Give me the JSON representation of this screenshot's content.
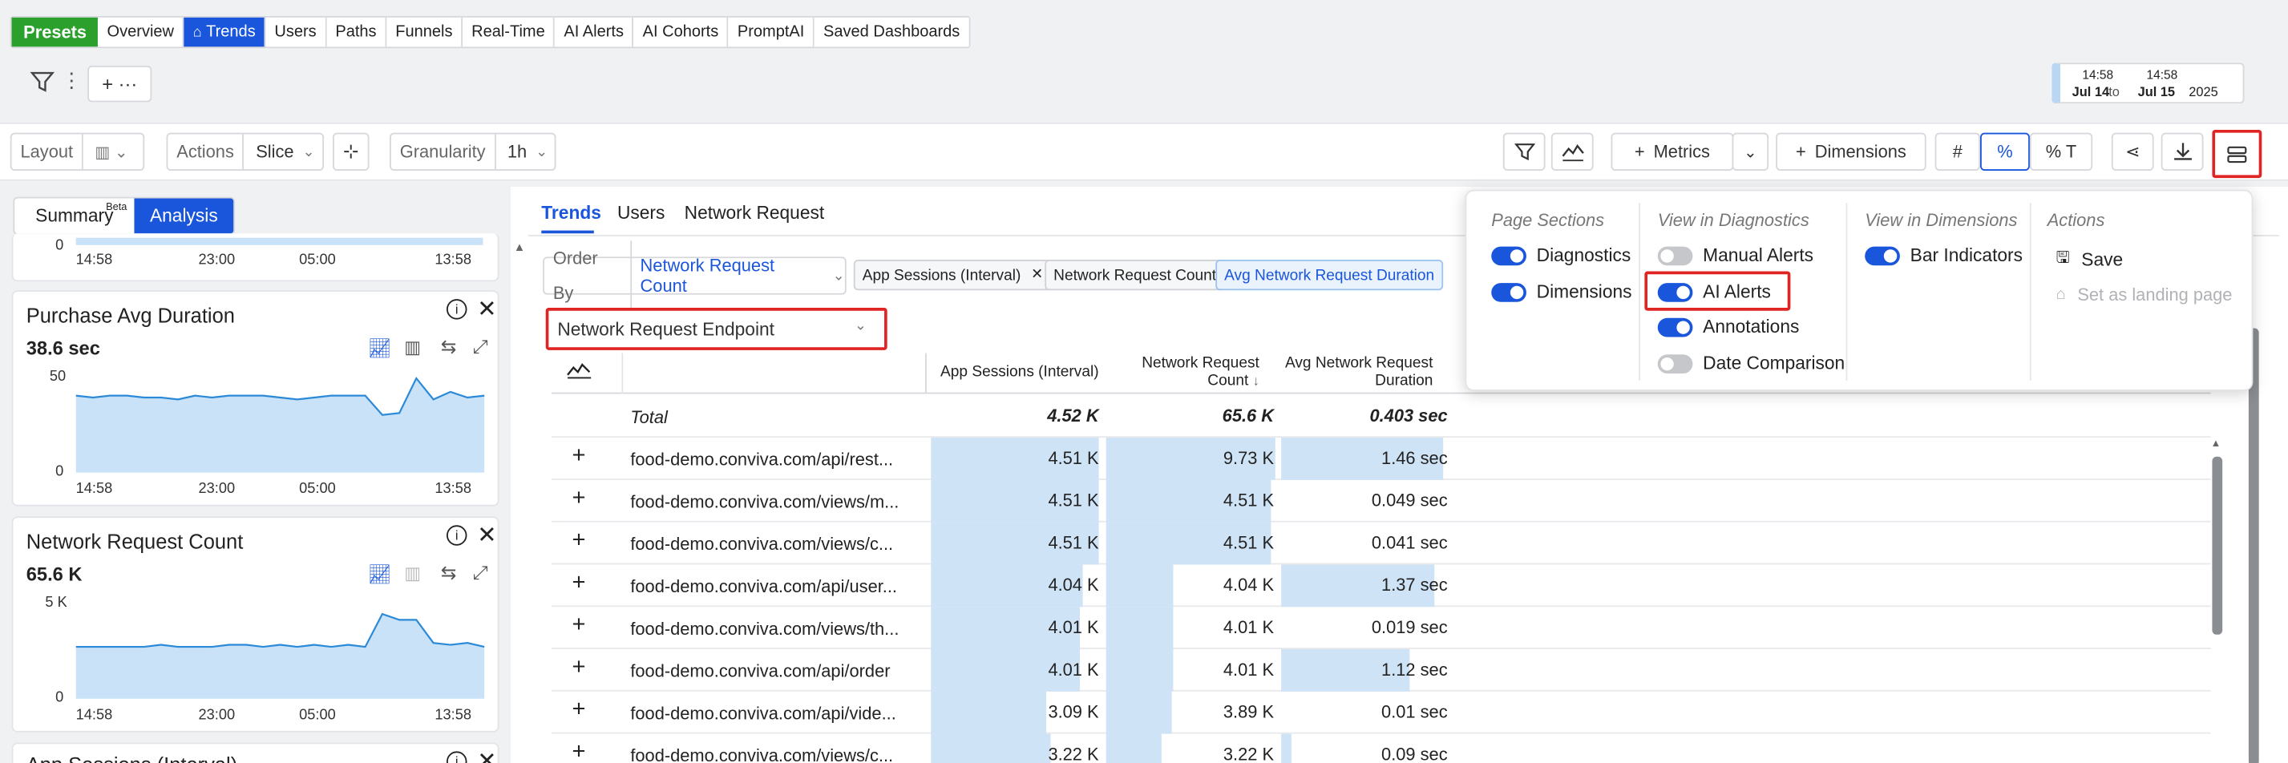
{
  "nav": {
    "presets": "Presets",
    "tabs": [
      "Overview",
      "Trends",
      "Users",
      "Paths",
      "Funnels",
      "Real-Time",
      "AI Alerts",
      "AI Cohorts",
      "PromptAI",
      "Saved Dashboards"
    ]
  },
  "date_range": {
    "start_time": "14:58",
    "start_date": "Jul 14",
    "to": "to",
    "end_time": "14:58",
    "end_date": "Jul 15",
    "year": "2025"
  },
  "filter": {
    "add_label": "+ ···"
  },
  "toolbar": {
    "layout_label": "Layout",
    "actions_label": "Actions",
    "slice_label": "Slice",
    "granularity_label": "Granularity",
    "granularity_value": "1h",
    "metrics_label": "Metrics",
    "dimensions_label": "Dimensions",
    "fmt_number": "#",
    "fmt_percent": "%",
    "fmt_percent_total": "% T"
  },
  "left": {
    "tabs": {
      "summary": "Summary",
      "beta": "Beta",
      "analysis": "Analysis"
    },
    "top_axis": {
      "zero": "0",
      "x": [
        "14:58",
        "23:00",
        "05:00",
        "13:58"
      ]
    },
    "panels": [
      {
        "title": "Purchase Avg Duration",
        "value": "38.6 sec",
        "y_top": "50",
        "y_zero": "0",
        "x": [
          "14:58",
          "23:00",
          "05:00",
          "13:58"
        ],
        "series": [
          40,
          39,
          40,
          40,
          39,
          39,
          38,
          40,
          39,
          40,
          40,
          40,
          39,
          38,
          39,
          40,
          40,
          40,
          30,
          31,
          49,
          38,
          42,
          39,
          40
        ]
      },
      {
        "title": "Network Request Count",
        "value": "65.6 K",
        "y_top": "5 K",
        "y_zero": "0",
        "x": [
          "14:58",
          "23:00",
          "05:00",
          "13:58"
        ],
        "series": [
          2.7,
          2.7,
          2.7,
          2.7,
          2.7,
          2.8,
          2.7,
          2.7,
          2.7,
          2.8,
          2.8,
          2.7,
          2.8,
          2.7,
          2.8,
          2.7,
          2.8,
          2.7,
          4.4,
          4.1,
          4.1,
          2.9,
          2.8,
          2.9,
          2.7
        ]
      },
      {
        "title": "App Sessions (Interval)"
      }
    ]
  },
  "main": {
    "tabs": [
      "Trends",
      "Users",
      "Network Request"
    ],
    "order_by_label": "Order By",
    "order_by_value": "Network Request Count",
    "chips": [
      "App Sessions (Interval)",
      "Network Request Count",
      "Avg Network Request Duration"
    ],
    "dimension": "Network Request Endpoint",
    "columns": [
      "App Sessions (Interval)",
      "Network Request Count",
      "Avg Network Request Duration"
    ],
    "total": {
      "label": "Total",
      "values": [
        "4.52 K",
        "65.6 K",
        "0.403 sec"
      ]
    },
    "rows": [
      {
        "endpoint": "food-demo.conviva.com/api/rest...",
        "v1": "4.51 K",
        "v2": "9.73 K",
        "v3": "1.46 sec",
        "f1": 1.0,
        "f2": 1.0,
        "f3": 0.97
      },
      {
        "endpoint": "food-demo.conviva.com/views/m...",
        "v1": "4.51 K",
        "v2": "4.51 K",
        "v3": "0.049 sec",
        "f1": 1.0,
        "f2": 0.97,
        "f3": 0.0
      },
      {
        "endpoint": "food-demo.conviva.com/views/c...",
        "v1": "4.51 K",
        "v2": "4.51 K",
        "v3": "0.041 sec",
        "f1": 1.0,
        "f2": 0.97,
        "f3": 0.0
      },
      {
        "endpoint": "food-demo.conviva.com/api/user...",
        "v1": "4.04 K",
        "v2": "4.04 K",
        "v3": "1.37 sec",
        "f1": 0.9,
        "f2": 0.4,
        "f3": 0.92
      },
      {
        "endpoint": "food-demo.conviva.com/views/th...",
        "v1": "4.01 K",
        "v2": "4.01 K",
        "v3": "0.019 sec",
        "f1": 0.89,
        "f2": 0.4,
        "f3": 0.0
      },
      {
        "endpoint": "food-demo.conviva.com/api/order",
        "v1": "4.01 K",
        "v2": "4.01 K",
        "v3": "1.12 sec",
        "f1": 0.89,
        "f2": 0.4,
        "f3": 0.77
      },
      {
        "endpoint": "food-demo.conviva.com/api/vide...",
        "v1": "3.09 K",
        "v2": "3.89 K",
        "v3": "0.01 sec",
        "f1": 0.69,
        "f2": 0.39,
        "f3": 0.0
      },
      {
        "endpoint": "food-demo.conviva.com/views/c...",
        "v1": "3.22 K",
        "v2": "3.22 K",
        "v3": "0.09 sec",
        "f1": 0.71,
        "f2": 0.33,
        "f3": 0.06
      }
    ]
  },
  "menu": {
    "page_sections": {
      "title": "Page Sections",
      "items": [
        {
          "label": "Diagnostics",
          "on": true
        },
        {
          "label": "Dimensions",
          "on": true
        }
      ]
    },
    "view_diag": {
      "title": "View in Diagnostics",
      "items": [
        {
          "label": "Manual Alerts",
          "on": false
        },
        {
          "label": "AI Alerts",
          "on": true
        },
        {
          "label": "Annotations",
          "on": true
        },
        {
          "label": "Date Comparison",
          "on": false
        }
      ]
    },
    "view_dim": {
      "title": "View in Dimensions",
      "items": [
        {
          "label": "Bar Indicators",
          "on": true
        }
      ]
    },
    "actions": {
      "title": "Actions",
      "save": "Save",
      "landing": "Set as landing page"
    }
  },
  "colors": {
    "green": "#2ca02c",
    "blue": "#1a56db",
    "highlight": "#e02424",
    "bar": "#cfe3f6"
  }
}
